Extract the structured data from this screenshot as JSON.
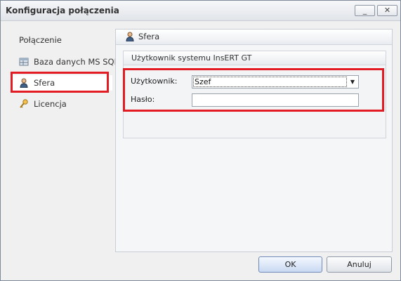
{
  "window": {
    "title": "Konfiguracja połączenia",
    "minimize_label": "_",
    "close_label": "✕"
  },
  "sidebar": {
    "header": "Połączenie",
    "items": [
      {
        "label": "Baza danych MS SQL",
        "icon": "database-icon"
      },
      {
        "label": "Sfera",
        "icon": "user-icon",
        "selected": true
      },
      {
        "label": "Licencja",
        "icon": "key-icon"
      }
    ]
  },
  "content": {
    "title": "Sfera",
    "group_title": "Użytkownik systemu InsERT GT",
    "user_label": "Użytkownik:",
    "user_value": "Szef",
    "password_label": "Hasło:",
    "password_value": ""
  },
  "buttons": {
    "ok": "OK",
    "cancel": "Anuluj"
  },
  "colors": {
    "highlight_red": "#e31b23",
    "selected_bg": "#ffffff"
  }
}
